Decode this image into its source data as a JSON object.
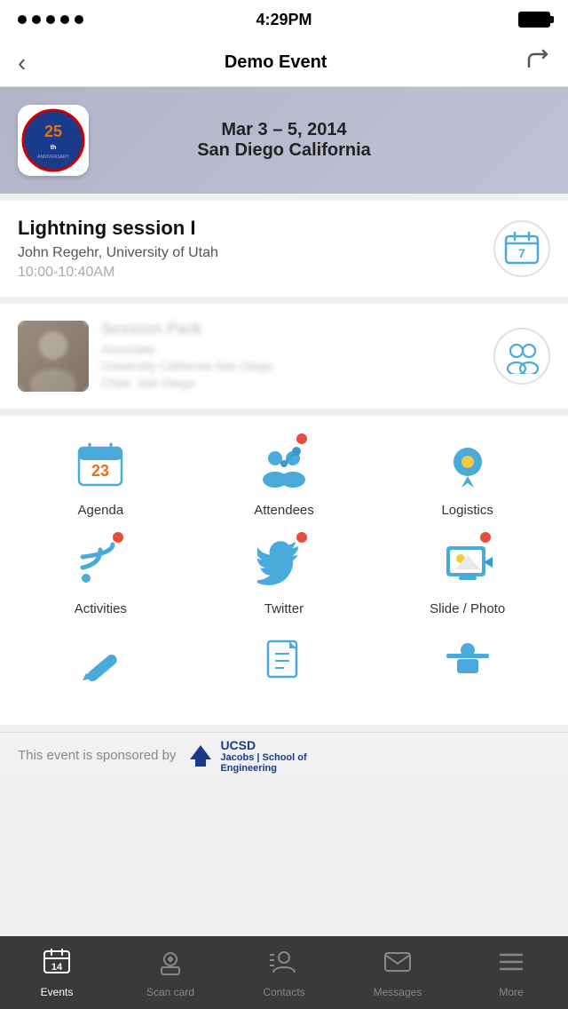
{
  "statusBar": {
    "time": "4:29PM"
  },
  "navBar": {
    "title": "Demo Event",
    "backLabel": "<",
    "shareLabel": "↗"
  },
  "hero": {
    "date": "Mar 3 – 5, 2014",
    "location": "San Diego California"
  },
  "sessionCard1": {
    "title": "Lightning session I",
    "subtitle": "John Regehr, University of Utah",
    "time": "10:00-10:40AM",
    "calNumber": "7"
  },
  "gridMenu": {
    "items": [
      {
        "id": "agenda",
        "label": "Agenda",
        "hasDot": false
      },
      {
        "id": "attendees",
        "label": "Attendees",
        "hasDot": true
      },
      {
        "id": "logistics",
        "label": "Logistics",
        "hasDot": false
      },
      {
        "id": "activities",
        "label": "Activities",
        "hasDot": true
      },
      {
        "id": "twitter",
        "label": "Twitter",
        "hasDot": true
      },
      {
        "id": "slide-photo",
        "label": "Slide / Photo",
        "hasDot": true
      }
    ]
  },
  "sponsorBar": {
    "text": "This event is sponsored by",
    "logoText": "UCSD",
    "logoSub1": "Jacobs",
    "logoSub2": "School of",
    "logoSub3": "Engineering"
  },
  "tabBar": {
    "items": [
      {
        "id": "events",
        "label": "Events",
        "active": true
      },
      {
        "id": "scan-card",
        "label": "Scan card",
        "active": false
      },
      {
        "id": "contacts",
        "label": "Contacts",
        "active": false
      },
      {
        "id": "messages",
        "label": "Messages",
        "active": false
      },
      {
        "id": "more",
        "label": "More",
        "active": false
      }
    ]
  }
}
